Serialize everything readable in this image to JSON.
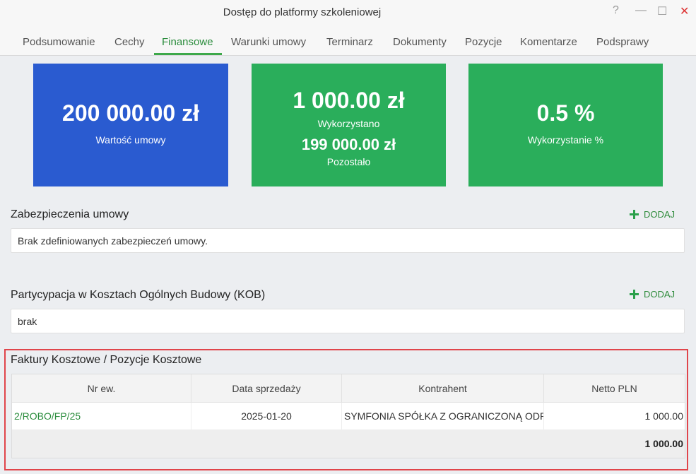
{
  "window": {
    "title": "Dostęp do platformy szkoleniowej",
    "help": "?",
    "minimize": "—",
    "maximize": "☐",
    "close": "✕"
  },
  "tabs": [
    {
      "label": "Podsumowanie"
    },
    {
      "label": "Cechy"
    },
    {
      "label": "Finansowe",
      "active": true
    },
    {
      "label": "Warunki umowy"
    },
    {
      "label": "Terminarz"
    },
    {
      "label": "Dokumenty"
    },
    {
      "label": "Pozycje"
    },
    {
      "label": "Komentarze"
    },
    {
      "label": "Podsprawy"
    }
  ],
  "cards": {
    "contract_value": {
      "value": "200 000.00 zł",
      "label": "Wartość umowy",
      "color": "#2a5bd0"
    },
    "used": {
      "value": "1 000.00 zł",
      "label": "Wykorzystano",
      "remaining_value": "199 000.00 zł",
      "remaining_label": "Pozostało",
      "color": "#2aae5b"
    },
    "usage_percent": {
      "value": "0.5 %",
      "label": "Wykorzystanie %",
      "color": "#2aae5b"
    }
  },
  "security": {
    "title": "Zabezpieczenia umowy",
    "add_label": "DODAJ",
    "text": "Brak zdefiniowanych zabezpieczeń umowy."
  },
  "kob": {
    "title": "Partycypacja w Kosztach Ogólnych Budowy (KOB)",
    "add_label": "DODAJ",
    "text": "brak"
  },
  "invoices": {
    "title": "Faktury Kosztowe / Pozycje Kosztowe",
    "columns": [
      "Nr ew.",
      "Data sprzedaży",
      "Kontrahent",
      "Netto PLN"
    ],
    "rows": [
      {
        "nr": "2/ROBO/FP/25",
        "date": "2025-01-20",
        "contractor": "SYMFONIA SPÓŁKA Z OGRANICZONĄ ODPOWIEDZIALNOŚCIĄ",
        "net": "1 000.00"
      }
    ],
    "total": "1 000.00"
  },
  "colors": {
    "accent_green": "#2a8c3c",
    "highlight_red": "#e0454b"
  }
}
